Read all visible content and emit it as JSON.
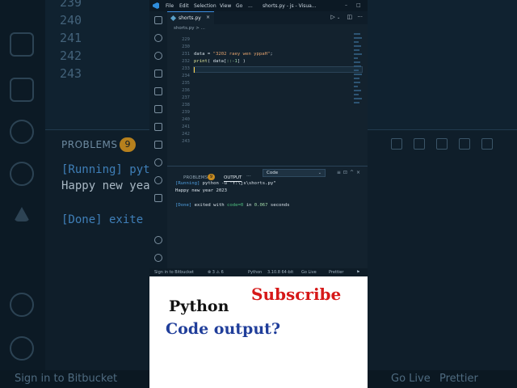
{
  "window": {
    "title": "shorts.py - js - Visua...",
    "menu": [
      "File",
      "Edit",
      "Selection",
      "View",
      "Go",
      "..."
    ]
  },
  "tab": {
    "label": "shorts.py",
    "close": "×"
  },
  "breadcrumb": "shorts.py > ...",
  "editor": {
    "line_numbers": [
      "229",
      "230",
      "231",
      "232",
      "233",
      "234",
      "235",
      "236",
      "237",
      "238",
      "239",
      "240",
      "241",
      "242",
      "243"
    ],
    "code": {
      "line231_var": "data",
      "line231_eq": " = ",
      "line231_str": "\"3202 raey wen yppaH\"",
      "line231_end": ";",
      "line232_fn": "print",
      "line232_rest_a": "( data[",
      "line232_slice": "::-1",
      "line232_rest_b": "] )"
    },
    "current_line": "233"
  },
  "panel": {
    "tabs": {
      "problems": "PROBLEMS",
      "output": "OUTPUT",
      "more": "···"
    },
    "problems_count": "9",
    "output_channel": "Code",
    "output": {
      "running_tag": "[Running]",
      "running_cmd": " python -u \"f:\\js\\shorts.py\"",
      "result": "Happy new year 2023",
      "done_tag": "[Done]",
      "done_a": " exited with ",
      "done_code": "code=0",
      "done_b": " in ",
      "done_time": "0.067",
      "done_c": " seconds"
    }
  },
  "statusbar": {
    "bitbucket": "Sign in to Bitbucket",
    "errors": "⊗ 3 ⚠ 6",
    "language": "Python",
    "interpreter": "3.10.8 64-bit",
    "golive": "Go Live",
    "prettier": "Prettier"
  },
  "background": {
    "line_numbers": [
      "239",
      "240",
      "241",
      "242",
      "243"
    ],
    "problems": "PROBLEMS",
    "problems_count": "9",
    "running": "[Running] pyt",
    "result": "Happy new yea",
    "done": "[Done] exite",
    "status_left": "Sign in to Bitbucket",
    "status_golive": "Go Live",
    "status_prettier": "Prettier"
  },
  "caption": {
    "subscribe": "Subscribe",
    "python": "Python",
    "question": "Code output?"
  },
  "colors": {
    "subscribe": "#d61818",
    "question": "#203e9a",
    "accent": "#3d8ee0"
  }
}
